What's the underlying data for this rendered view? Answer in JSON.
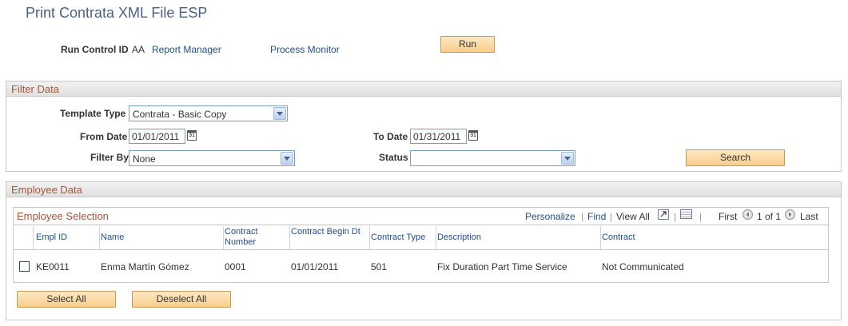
{
  "page": {
    "title": "Print Contrata XML File ESP"
  },
  "run_control": {
    "label": "Run Control ID",
    "value": "AA",
    "report_manager": "Report Manager",
    "process_monitor": "Process Monitor",
    "run_button": "Run"
  },
  "filter": {
    "title": "Filter Data",
    "template_type_label": "Template Type",
    "template_type_value": "Contrata - Basic Copy",
    "from_date_label": "From Date",
    "from_date_value": "01/01/2011",
    "to_date_label": "To Date",
    "to_date_value": "01/31/2011",
    "calendar_glyph": "31",
    "filter_by_label": "Filter By",
    "filter_by_value": "None",
    "status_label": "Status",
    "status_value": "",
    "search_button": "Search"
  },
  "employee": {
    "title": "Employee Data",
    "grid_title": "Employee Selection",
    "toolbar": {
      "personalize": "Personalize",
      "sep1": "|",
      "find": "Find",
      "sep2": "|",
      "view_all": "View All",
      "sep3": "|",
      "sep4": "|",
      "first": "First",
      "range": "1 of 1",
      "last": "Last"
    },
    "columns": {
      "empl_id": "Empl ID",
      "name": "Name",
      "contract_number": "Contract Number",
      "contract_begin": "Contract Begin Dt",
      "contract_type": "Contract Type",
      "description": "Description",
      "contract": "Contract"
    },
    "rows": [
      {
        "selected": false,
        "empl_id": "KE0011",
        "name": "Enma Martín Gómez",
        "contract_number": "0001",
        "contract_begin": "01/01/2011",
        "contract_type": "501",
        "description": "Fix Duration Part Time Service",
        "contract": "Not Communicated"
      }
    ],
    "select_all_button": "Select All",
    "deselect_all_button": "Deselect All"
  }
}
